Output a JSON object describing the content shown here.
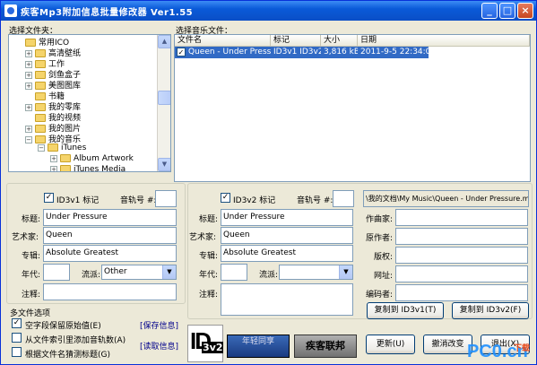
{
  "window": {
    "title": "疾客Mp3附加信息批量修改器 Ver1.55",
    "minimize": "_",
    "maximize": "□",
    "close": "×"
  },
  "folders": {
    "label": "选择文件夹：",
    "items": [
      "常用ICO",
      "高清壁纸",
      "工作",
      "剑鱼盒子",
      "美图图库",
      "书籍",
      "我的零库",
      "我的视频",
      "我的图片",
      "我的音乐",
      "iTunes",
      "Album Artwork",
      "iTunes Media"
    ]
  },
  "files": {
    "label": "选择音乐文件：",
    "columns": [
      "文件名",
      "标记",
      "大小",
      "日期"
    ],
    "rows": [
      {
        "name": "Queen - Under Pressure",
        "tag": "ID3v1 ID3v2",
        "size": "3,816 kB",
        "date": "2011-9-5 22:34:01"
      }
    ]
  },
  "id3v1": {
    "enable_label": "ID3v1 标记",
    "track_label": "音轨号 #:",
    "title_label": "标题:",
    "title": "Under Pressure",
    "artist_label": "艺术家:",
    "artist": "Queen",
    "album_label": "专辑:",
    "album": "Absolute Greatest",
    "year_label": "年代:",
    "genre_label": "流派:",
    "genre": "Other",
    "comment_label": "注释:"
  },
  "multi": {
    "label": "多文件选项",
    "opt1": "空字段保留原始值(E)",
    "opt2": "从文件索引里添加音轨数(A)",
    "opt3": "根据文件名猜测标题(G)",
    "save": "[保存信息]",
    "read": "[读取信息]"
  },
  "id3v2": {
    "enable_label": "ID3v2 标记",
    "track_label": "音轨号 #:",
    "path": "\\我的文档\\My Music\\Queen - Under Pressure.mp3",
    "title_label": "标题:",
    "title": "Under Pressure",
    "artist_label": "艺术家:",
    "artist": "Queen",
    "album_label": "专辑:",
    "album": "Absolute Greatest",
    "year_label": "年代:",
    "genre_label": "流派:",
    "comment_label": "注释:",
    "composer_label": "作曲家:",
    "orig_artist_label": "原作者:",
    "copyright_label": "版权:",
    "url_label": "网址:",
    "encoder_label": "编码者:",
    "copy_to_v1": "复制到 ID3v1(T)",
    "copy_to_v2": "复制到 ID3v2(F)"
  },
  "bottom": {
    "logo_id": "ID",
    "logo_3v2": "3v2",
    "banner1": "年轻同享",
    "banner2": "疾客联邦",
    "update": "更新(U)",
    "cancel": "撤消改变",
    "exit": "退出(X)"
  },
  "watermark": {
    "text": "PC0.cn",
    "sub": "下载"
  }
}
